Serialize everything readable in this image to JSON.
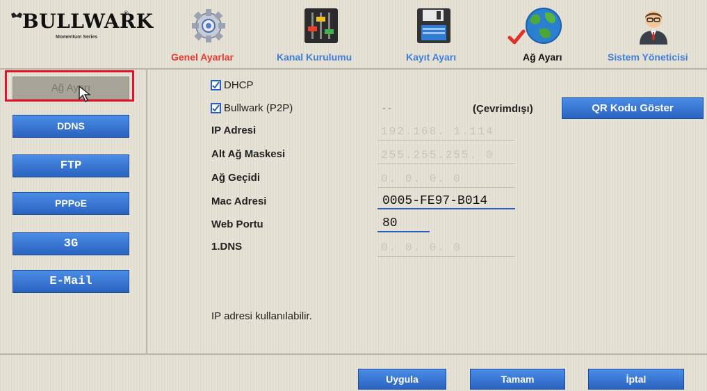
{
  "logo": {
    "name": "BULLWARK",
    "reg": "®",
    "subtitle": "Momentum Series"
  },
  "tabs": [
    {
      "label": "Genel Ayarlar",
      "icon": "gear-icon",
      "color": "#e33a2d"
    },
    {
      "label": "Kanal Kurulumu",
      "icon": "sliders-icon",
      "color": "#3f7fdb"
    },
    {
      "label": "Kayıt Ayarı",
      "icon": "floppy-disk-icon",
      "color": "#3f7fdb"
    },
    {
      "label": "Ağ Ayarı",
      "icon": "globe-icon",
      "color": "#111111",
      "active": true
    },
    {
      "label": "Sistem Yöneticisi",
      "icon": "admin-user-icon",
      "color": "#3f7fdb"
    }
  ],
  "sidebar": {
    "items": [
      {
        "label": "Ağ Ayarı",
        "selected": true
      },
      {
        "label": "DDNS"
      },
      {
        "label": "FTP"
      },
      {
        "label": "PPPoE"
      },
      {
        "label": "3G"
      },
      {
        "label": "E-Mail"
      }
    ]
  },
  "network": {
    "dhcp_label": "DHCP",
    "dhcp_checked": true,
    "p2p_label": "Bullwark (P2P)",
    "p2p_checked": true,
    "p2p_id": "--",
    "p2p_status": "(Çevrimdışı)",
    "qr_button": "QR Kodu Göster",
    "fields": [
      {
        "label": "IP Adresi",
        "value": "192.168.  1.114"
      },
      {
        "label": "Alt Ağ Maskesi",
        "value": "255.255.255.  0"
      },
      {
        "label": "Ağ Geçidi",
        "value": "  0.  0.  0.  0"
      },
      {
        "label": "Mac Adresi",
        "value": "0005-FE97-B014"
      },
      {
        "label": "Web Portu",
        "value": "80"
      },
      {
        "label": "1.DNS",
        "value": "  0.  0.  0.  0"
      }
    ],
    "status_message": "IP adresi kullanılabilir."
  },
  "footer": {
    "apply": "Uygula",
    "ok": "Tamam",
    "cancel": "İptal"
  },
  "colors": {
    "button_blue": "#2f6fd0",
    "highlight_red": "#e0142a",
    "active_check": "#e0322a"
  }
}
